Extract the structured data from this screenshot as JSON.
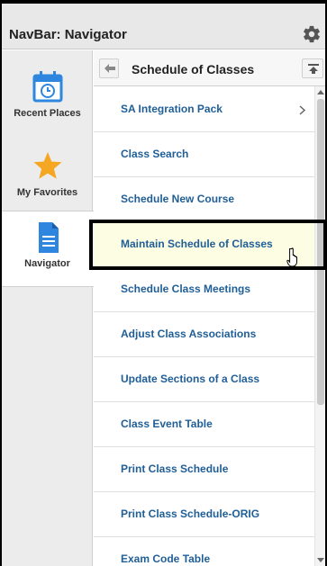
{
  "titlebar": {
    "title": "NavBar: Navigator",
    "settings_icon": "gear-icon"
  },
  "rail": {
    "items": [
      {
        "label": "Recent Places",
        "icon": "calendar-clock-icon"
      },
      {
        "label": "My Favorites",
        "icon": "star-icon"
      },
      {
        "label": "Navigator",
        "icon": "document-icon"
      }
    ]
  },
  "panel": {
    "title": "Schedule of Classes",
    "back_icon": "left-arrow-icon",
    "top_icon": "scroll-top-icon",
    "items": [
      {
        "label": "SA Integration Pack",
        "has_children": true
      },
      {
        "label": "Class Search"
      },
      {
        "label": "Schedule New Course"
      },
      {
        "label": "Maintain Schedule of Classes"
      },
      {
        "label": "Schedule Class Meetings"
      },
      {
        "label": "Adjust Class Associations"
      },
      {
        "label": "Update Sections of a Class"
      },
      {
        "label": "Class Event Table"
      },
      {
        "label": "Print Class Schedule"
      },
      {
        "label": "Print Class Schedule-ORIG"
      },
      {
        "label": "Exam Code Table"
      }
    ]
  },
  "colors": {
    "link": "#1f5e97",
    "star": "#f5a623",
    "doc": "#2e86de",
    "hover": "#fdfde3"
  }
}
